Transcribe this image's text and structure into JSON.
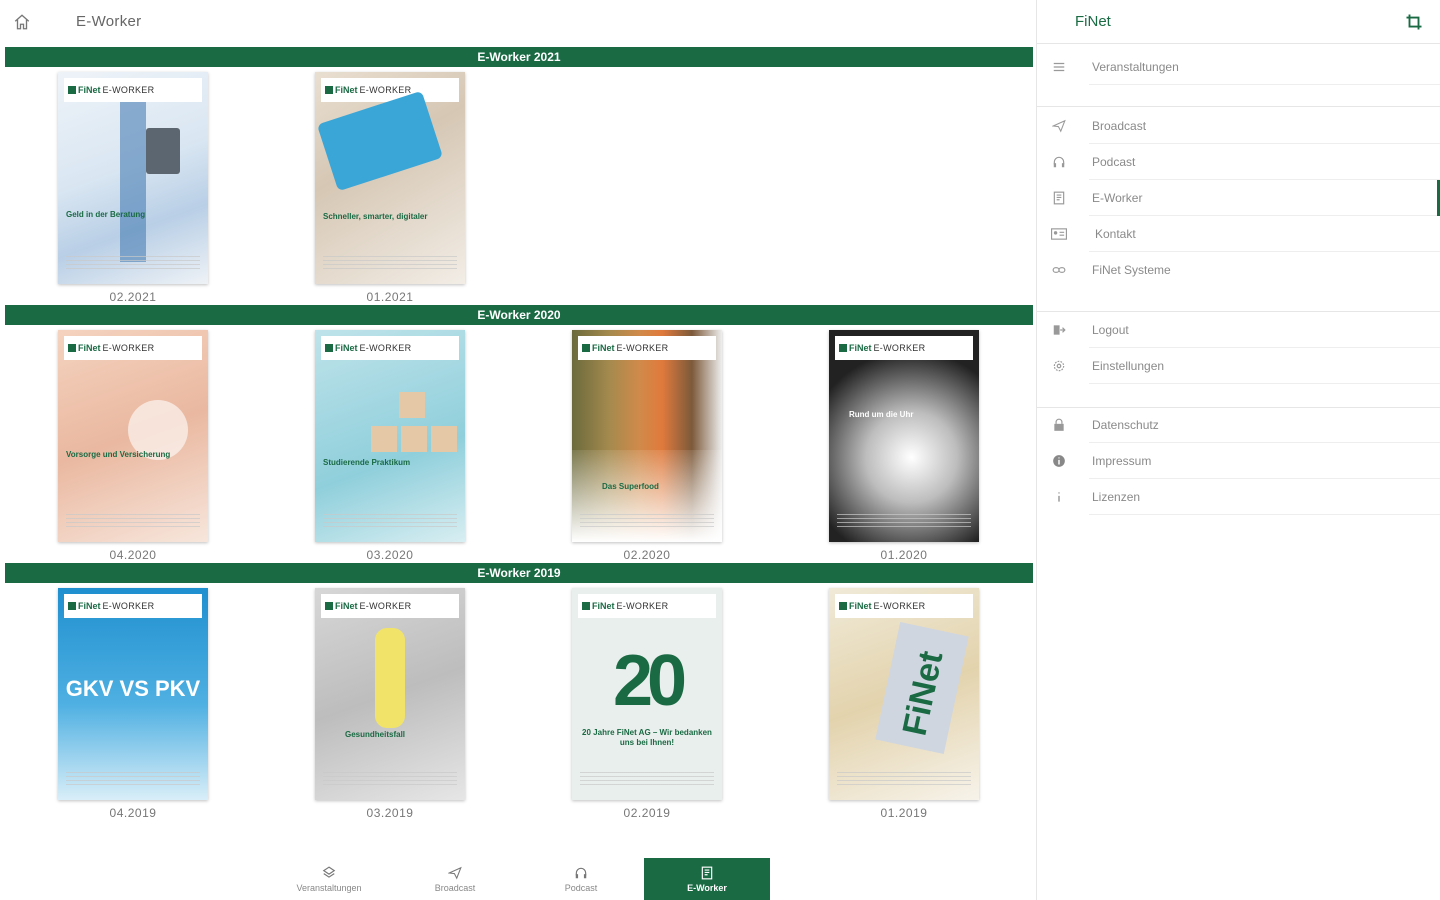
{
  "app_title": "E-Worker",
  "sections": [
    {
      "title": "E-Worker 2021",
      "items": [
        {
          "label": "02.2021",
          "caption": "Geld in der Beratung"
        },
        {
          "label": "01.2021",
          "caption": "Schneller, smarter, digitaler"
        }
      ]
    },
    {
      "title": "E-Worker 2020",
      "items": [
        {
          "label": "04.2020",
          "caption": "Vorsorge und Versicherung"
        },
        {
          "label": "03.2020",
          "caption": "Studierende Praktikum"
        },
        {
          "label": "02.2020",
          "caption": "Das Superfood"
        },
        {
          "label": "01.2020",
          "caption": "Rund um die Uhr"
        }
      ]
    },
    {
      "title": "E-Worker 2019",
      "items": [
        {
          "label": "04.2019",
          "caption": "GKV VS PKV"
        },
        {
          "label": "03.2019",
          "caption": "Gesundheitsfall"
        },
        {
          "label": "02.2019",
          "caption": "20 Jahre FiNet AG – Wir bedanken uns bei Ihnen!"
        },
        {
          "label": "01.2019",
          "caption": "FiNet"
        }
      ]
    }
  ],
  "cover_brand": "FiNet",
  "cover_brand_suffix": "E-WORKER",
  "bottom_nav": [
    {
      "label": "Veranstaltungen",
      "icon": "event-icon"
    },
    {
      "label": "Broadcast",
      "icon": "send-icon"
    },
    {
      "label": "Podcast",
      "icon": "headphones-icon"
    },
    {
      "label": "E-Worker",
      "icon": "magazine-icon",
      "active": true
    }
  ],
  "drawer": {
    "title": "FiNet",
    "menu": [
      {
        "label": "Veranstaltungen",
        "icon": "list-icon"
      },
      {
        "label": "Broadcast",
        "icon": "send-icon"
      },
      {
        "label": "Podcast",
        "icon": "headphones-icon"
      },
      {
        "label": "E-Worker",
        "icon": "magazine-icon",
        "active": true
      },
      {
        "label": "Kontakt",
        "icon": "contact-card-icon"
      },
      {
        "label": "FiNet Systeme",
        "icon": "link-icon"
      },
      {
        "label": "Logout",
        "icon": "logout-icon"
      },
      {
        "label": "Einstellungen",
        "icon": "gear-icon"
      },
      {
        "label": "Datenschutz",
        "icon": "lock-icon"
      },
      {
        "label": "Impressum",
        "icon": "info-icon"
      },
      {
        "label": "Lizenzen",
        "icon": "info-small-icon"
      }
    ]
  },
  "colors": {
    "accent": "#1a6a44"
  }
}
